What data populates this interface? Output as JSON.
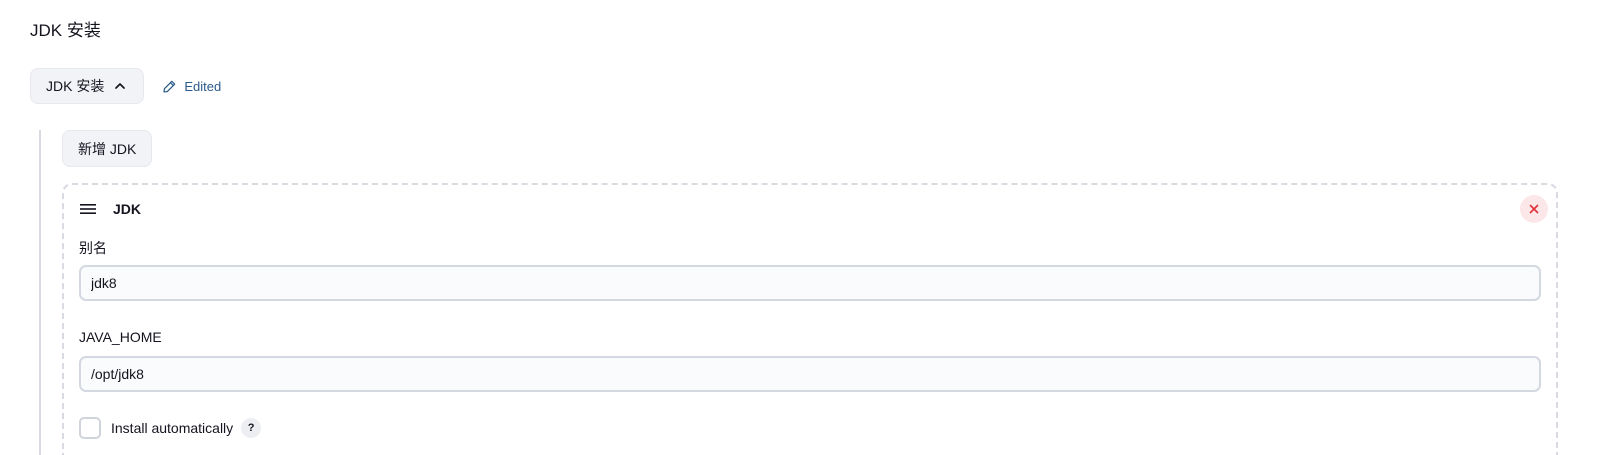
{
  "section": {
    "title": "JDK 安装"
  },
  "toggle": {
    "label": "JDK 安装",
    "icon": "chevron-up-icon",
    "expanded": true
  },
  "status": {
    "label": "Edited",
    "icon": "pencil-icon",
    "color": "#2b5a8a"
  },
  "add_button": {
    "label": "新增 JDK"
  },
  "jdk_card": {
    "title": "JDK",
    "drag_icon": "drag-handle-icon",
    "close_icon": "close-icon",
    "close_color": "#e0303a",
    "alias": {
      "label": "别名",
      "value": "jdk8"
    },
    "java_home": {
      "label": "JAVA_HOME",
      "value": "/opt/jdk8"
    },
    "install_automatically": {
      "label": "Install automatically",
      "checked": false,
      "help": "?"
    }
  }
}
